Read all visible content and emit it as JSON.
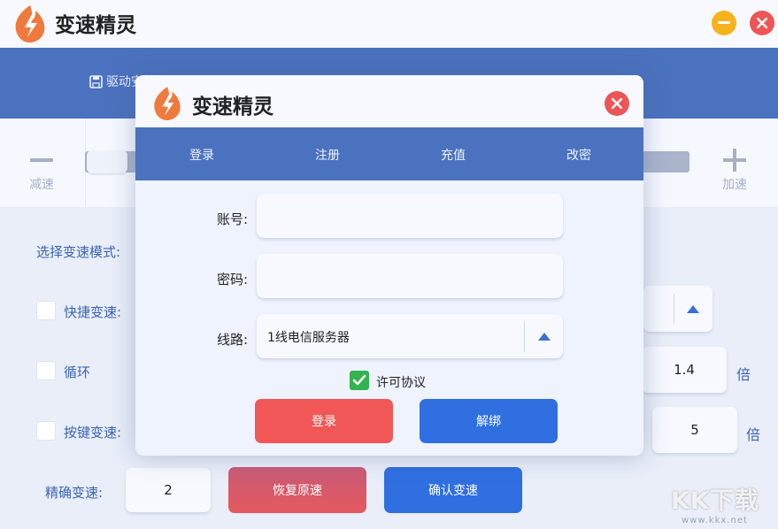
{
  "app": {
    "title": "变速精灵"
  },
  "toolbar": {
    "driver_label": "驱动安装"
  },
  "speed": {
    "decrease_label": "减速",
    "increase_label": "加速"
  },
  "main": {
    "mode_label": "选择变速模式:",
    "quick_label": "快捷变速:",
    "loop_label": "循环",
    "loop_value": "1.4",
    "loop_unit": "倍",
    "hotkey_label": "按键变速:",
    "hotkey_value": "5",
    "hotkey_unit": "倍",
    "precise_label": "精确变速:",
    "precise_value": "2",
    "restore_button": "恢复原速",
    "confirm_button": "确认变速"
  },
  "dialog": {
    "title": "变速精灵",
    "tabs": [
      "登录",
      "注册",
      "充值",
      "改密"
    ],
    "account_label": "账号:",
    "account_value": "",
    "password_label": "密码:",
    "password_value": "",
    "line_label": "线路:",
    "line_value": "1线电信服务器",
    "agree_label": "许可协议",
    "agree_checked": true,
    "login_button": "登录",
    "unbind_button": "解绑"
  },
  "watermark": {
    "text": "KK下载",
    "url": "www.kkx.net"
  },
  "colors": {
    "header_blue": "#4b72bf",
    "logo_orange": "#f07a3e",
    "close_red": "#ee5555",
    "minimize_yellow": "#f7b21c",
    "login_red": "#f25757",
    "unbind_blue": "#2f6fe0",
    "check_green": "#33b34f",
    "label_blue": "#3a63b4"
  },
  "icons": [
    "flame-logo-icon",
    "minimize-icon",
    "close-icon",
    "save-icon",
    "minus-icon",
    "plus-icon",
    "checkmark-icon",
    "chevron-up-icon"
  ]
}
